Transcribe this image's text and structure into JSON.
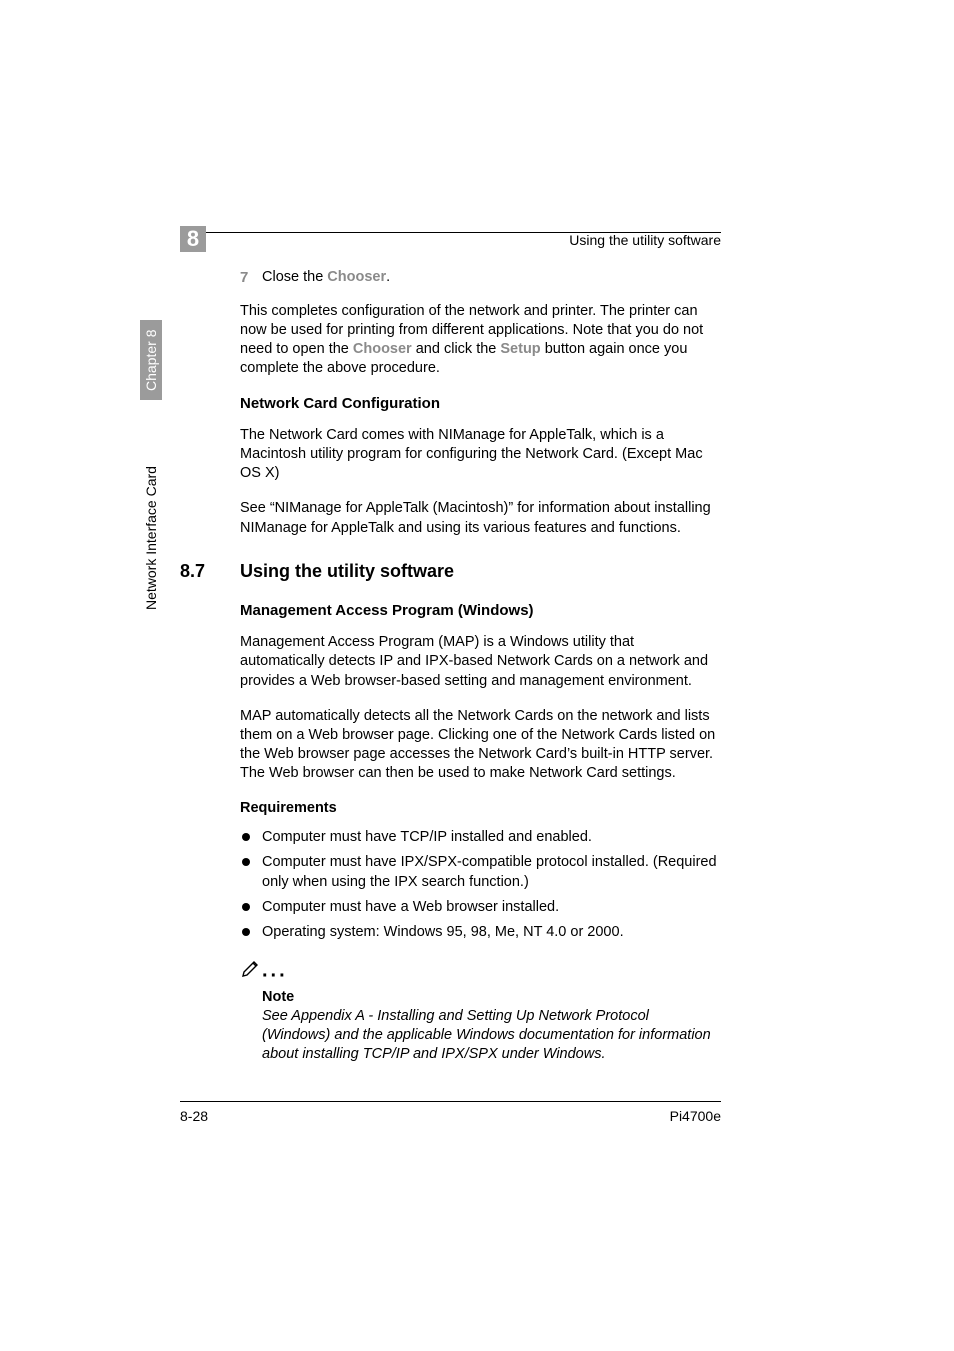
{
  "header": {
    "chapter_num": "8",
    "title": "Using the utility software"
  },
  "side": {
    "chapter": "Chapter 8",
    "label": "Network Interface Card"
  },
  "step7": {
    "num": "7",
    "pre": "Close the ",
    "chooser": "Chooser",
    "post": "."
  },
  "para1": {
    "p1": "This completes configuration of the network and printer. The printer can now be used for printing from different applications. Note that you do not need to open the ",
    "chooser": "Chooser",
    "p2": " and click the ",
    "setup": "Setup",
    "p3": " button again once you complete the above procedure."
  },
  "h3_netcard": "Network Card Configuration",
  "para2": "The Network Card comes with NIManage for AppleTalk, which is a Macintosh utility program for configuring the Network Card. (Except Mac OS X)",
  "para3": "See “NIManage for AppleTalk (Macintosh)” for information about installing NIManage for AppleTalk and using its various features and functions.",
  "section": {
    "num": "8.7",
    "title": "Using the utility software"
  },
  "h3_map": "Management Access Program (Windows)",
  "para4": "Management Access Program (MAP) is a Windows utility that automatically detects IP and IPX-based Network Cards on a network and provides a Web browser-based setting and management environment.",
  "para5": "MAP automatically detects all the Network Cards on the network and lists them on a Web browser page. Clicking one of the Network Cards listed on the Web browser page accesses the Network Card’s built-in HTTP server. The Web browser can then be used to make Network Card settings.",
  "h4_req": "Requirements",
  "bullets": [
    "Computer must have TCP/IP installed and enabled.",
    "Computer must have IPX/SPX-compatible protocol installed. (Required only when using the IPX search function.)",
    "Computer must have a Web browser installed.",
    "Operating system: Windows 95, 98, Me, NT 4.0 or 2000."
  ],
  "note": {
    "title": "Note",
    "body": "See Appendix A - Installing and Setting Up Network Protocol (Windows) and the applicable Windows documentation for information about installing TCP/IP and IPX/SPX under Windows."
  },
  "footer": {
    "left": "8-28",
    "right": "Pi4700e"
  }
}
